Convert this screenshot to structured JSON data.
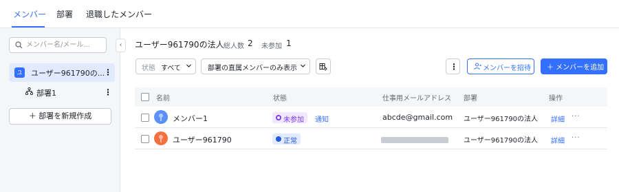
{
  "tabs": [
    {
      "label": "メンバー",
      "active": true
    },
    {
      "label": "部署",
      "active": false
    },
    {
      "label": "退職したメンバー",
      "active": false
    }
  ],
  "sidebar": {
    "search_placeholder": "メンバー名/メール...",
    "collapse_glyph": "‹",
    "org": {
      "badge": "ユ",
      "label": "ユーザー961790の..."
    },
    "department": {
      "label": "部署1"
    },
    "new_department_label": "＋ 部署を新規作成"
  },
  "main": {
    "org_title": "ユーザー961790の法人",
    "total_label": "総人数",
    "total_value": "2",
    "not_joined_label": "未参加",
    "not_joined_value": "1",
    "filter_status_label": "状態",
    "filter_status_value": "すべて",
    "filter_direct_label": "部署の直属メンバーのみ表示",
    "invite_label": "メンバーを招待",
    "add_label": "＋ メンバーを追加"
  },
  "table": {
    "headers": {
      "name": "名前",
      "status": "状態",
      "email": "仕事用メールアドレス",
      "department": "部署",
      "actions": "操作"
    },
    "rows": [
      {
        "name": "メンバー1",
        "status": "未参加",
        "status_action": "通知",
        "email": "abcde@gmail.com",
        "department": "ユーザー961790の法人",
        "detail": "詳細",
        "more": "···"
      },
      {
        "name": "ユーザー961790",
        "status": "正常",
        "status_action": "",
        "email": "",
        "department": "ユーザー961790の法人",
        "detail": "詳細",
        "more": "···"
      }
    ]
  },
  "colors": {
    "accent": "#3370ff",
    "pending_bg": "#f0e8ff",
    "pending_fg": "#7f3bf5",
    "normal_bg": "#e1eaff",
    "normal_fg": "#245bdb",
    "avatar_member": "#5b8ff9",
    "avatar_user": "#f5703f"
  }
}
